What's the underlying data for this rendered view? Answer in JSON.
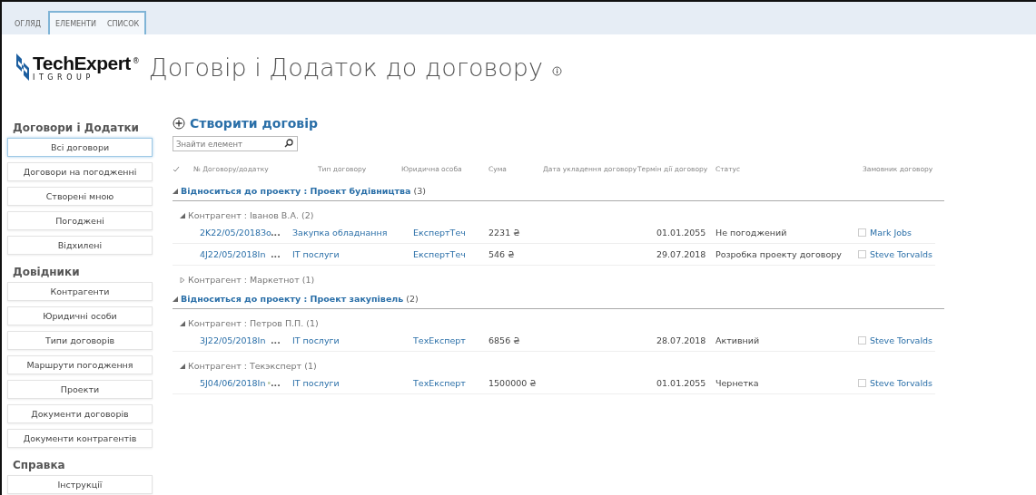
{
  "ribbon_tabs": [
    {
      "label": "ОГЛЯД",
      "kind": "plain"
    },
    {
      "label": "ЕЛЕМЕНТИ",
      "kind": "contextual"
    },
    {
      "label": "СПИСОК",
      "kind": "contextual"
    }
  ],
  "logo": {
    "name": "TechExpert",
    "mark": "®",
    "tagline": "I T G R O U P"
  },
  "page_title": "Договір і Додаток до договору",
  "sidebar": [
    {
      "heading": "Договори і Додатки",
      "items": [
        {
          "label": "Всі договори",
          "selected": true
        },
        {
          "label": "Договори на погодженні",
          "selected": false
        },
        {
          "label": "Створені мною",
          "selected": false
        },
        {
          "label": "Погоджені",
          "selected": false
        },
        {
          "label": "Відхилені",
          "selected": false
        }
      ]
    },
    {
      "heading": "Довідники",
      "items": [
        {
          "label": "Контрагенти",
          "selected": false
        },
        {
          "label": "Юридичні особи",
          "selected": false
        },
        {
          "label": "Типи договорів",
          "selected": false
        },
        {
          "label": "Маршрути погодження",
          "selected": false
        },
        {
          "label": "Проекти",
          "selected": false
        },
        {
          "label": "Документи договорів",
          "selected": false
        },
        {
          "label": "Документи контрагентів",
          "selected": false
        }
      ]
    },
    {
      "heading": "Справка",
      "items": [
        {
          "label": "Інструкції",
          "selected": false
        }
      ]
    }
  ],
  "create_link": "Створити договір",
  "search": {
    "placeholder": "Знайти елемент"
  },
  "table": {
    "columns": [
      "№ Договору/додатку",
      "Тип договору",
      "Юридична особа",
      "Сума",
      "Дата укладення договору",
      "Термін дії договору",
      "Статус",
      "Замовник договору"
    ],
    "groups": [
      {
        "label": "Відноситься до проекту : Проект будівництва",
        "count": "(3)",
        "expanded": true,
        "children": [
          {
            "label": "Контрагент : Іванов В.А.",
            "count": "(2)",
            "expanded": true,
            "rows": [
              {
                "number": "2K22/05/2018Зо",
                "marked": false,
                "menu": "...",
                "type": "Закупка обладнання",
                "entity": "ЕкспертТеч",
                "sum": "2231 ₴",
                "term": "01.01.2055",
                "status": "Не погоджений",
                "customer": "Mark Jobs"
              },
              {
                "number": "4J22/05/2018In",
                "marked": false,
                "menu": "...",
                "type": "IT послуги",
                "entity": "ЕкспертТеч",
                "sum": "546 ₴",
                "term": "29.07.2018",
                "status": "Розробка проекту договору",
                "customer": "Steve Torvalds"
              }
            ]
          },
          {
            "label": "Контрагент : Маркетнот",
            "count": "(1)",
            "expanded": false
          }
        ]
      },
      {
        "label": "Відноситься до проекту : Проект закупівель",
        "count": "(2)",
        "expanded": true,
        "children": [
          {
            "label": "Контрагент : Петров П.П.",
            "count": "(1)",
            "expanded": true,
            "rows": [
              {
                "number": "3J22/05/2018In",
                "marked": false,
                "menu": "...",
                "type": "IT послуги",
                "entity": "ТехЕксперт",
                "sum": "6856 ₴",
                "term": "28.07.2018",
                "status": "Активний",
                "customer": "Steve Torvalds"
              }
            ]
          },
          {
            "label": "Контрагент : Текэксперт",
            "count": "(1)",
            "expanded": true,
            "rows": [
              {
                "number": "5J04/06/2018In",
                "marked": true,
                "menu": "...",
                "type": "IT послуги",
                "entity": "ТехЕксперт",
                "sum": "1500000 ₴",
                "term": "01.01.2055",
                "status": "Чернетка",
                "customer": "Steve Torvalds"
              }
            ]
          }
        ]
      }
    ]
  }
}
